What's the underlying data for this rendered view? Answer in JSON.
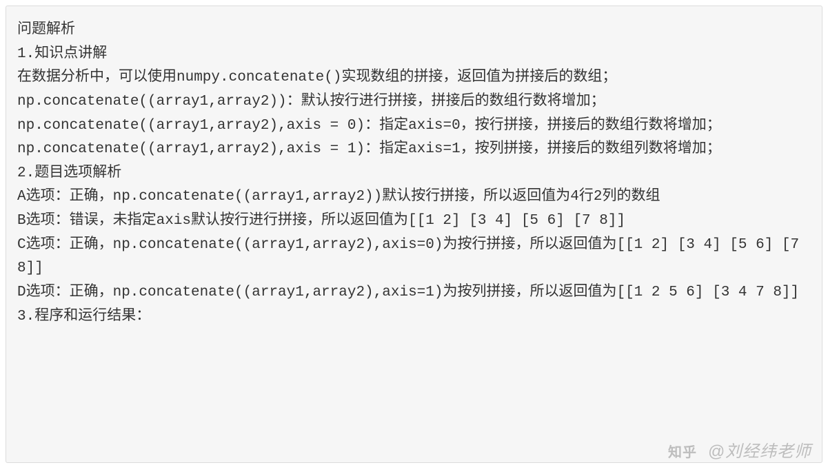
{
  "lines": [
    "问题解析",
    "1.知识点讲解",
    "在数据分析中，可以使用numpy.concatenate()实现数组的拼接，返回值为拼接后的数组；",
    "np.concatenate((array1,array2))：默认按行进行拼接，拼接后的数组行数将增加；",
    "np.concatenate((array1,array2),axis = 0)：指定axis=0，按行拼接，拼接后的数组行数将增加；",
    "np.concatenate((array1,array2),axis = 1)：指定axis=1，按列拼接，拼接后的数组列数将增加；",
    "2.题目选项解析",
    "A选项：正确，np.concatenate((array1,array2))默认按行拼接，所以返回值为4行2列的数组",
    "B选项：错误，未指定axis默认按行进行拼接，所以返回值为[[1 2] [3 4] [5 6] [7 8]]",
    "C选项：正确，np.concatenate((array1,array2),axis=0)为按行拼接，所以返回值为[[1 2] [3 4] [5 6] [7 8]]",
    "D选项：正确，np.concatenate((array1,array2),axis=1)为按列拼接，所以返回值为[[1 2 5 6] [3 4 7 8]]",
    "3.程序和运行结果："
  ],
  "watermark": {
    "logo": "知乎",
    "text": "@刘经纬老师"
  }
}
